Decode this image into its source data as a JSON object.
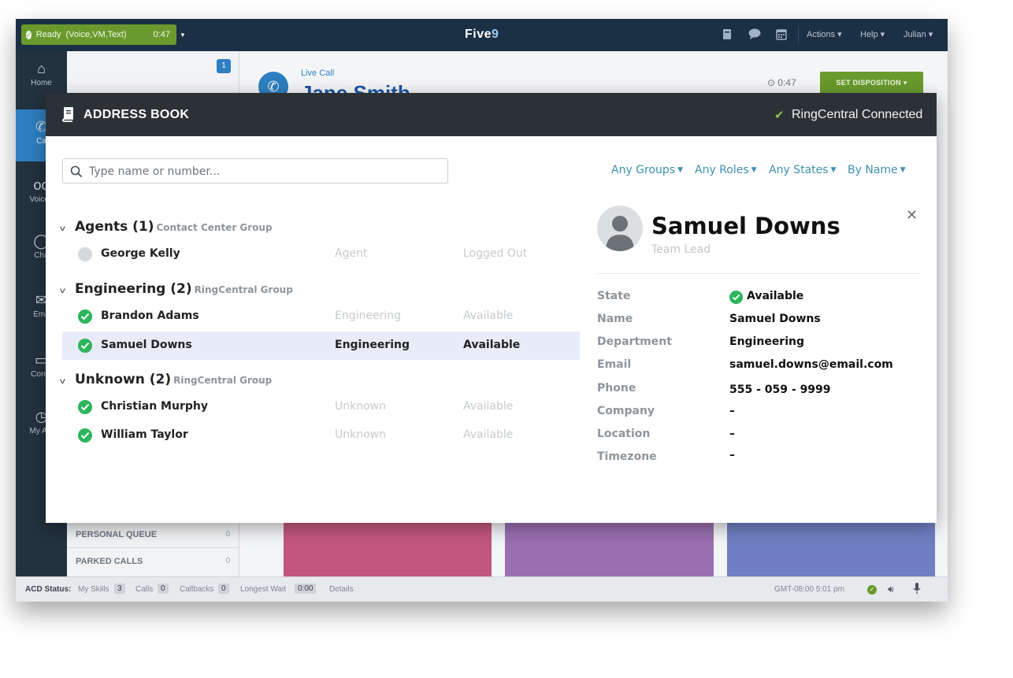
{
  "app": {
    "status_label": "Ready",
    "status_channels": "(Voice,VM,Text)",
    "status_timer": "0:47",
    "logo_text": "Five",
    "logo_nine": "9",
    "menu_actions": "Actions ▾",
    "menu_help": "Help ▾",
    "menu_user": "Julian ▾",
    "nav": [
      {
        "label": "Home",
        "icon": "home-icon"
      },
      {
        "label": "Ca",
        "icon": "phone-icon"
      },
      {
        "label": "Voicen",
        "icon": "voicemail-icon"
      },
      {
        "label": "Cha",
        "icon": "chat-icon"
      },
      {
        "label": "Ema",
        "icon": "email-icon"
      },
      {
        "label": "Conta",
        "icon": "folder-icon"
      },
      {
        "label": "My Act",
        "icon": "clock-icon"
      }
    ],
    "queue_badge": "1",
    "queues": [
      {
        "label": "PERSONAL QUEUE",
        "count": "0"
      },
      {
        "label": "PARKED CALLS",
        "count": "0"
      }
    ],
    "call": {
      "live_label": "Live Call",
      "caller_name": "Jane Smith",
      "timer": "⊙ 0:47",
      "disposition_label": "SET DISPOSITION ▾"
    },
    "footer": {
      "acd_label": "ACD Status:",
      "skills_label": "My Skills",
      "skills_count": "3",
      "calls_label": "Calls",
      "calls_count": "0",
      "callbacks_label": "Callbacks",
      "callbacks_count": "0",
      "wait_label": "Longest Wait",
      "wait_value": "0:00",
      "details_label": "Details",
      "clock": "GMT-08:00 5:01 pm"
    },
    "tile_colors": [
      "#c2577e",
      "#9a6fb0",
      "#6f7fc2"
    ]
  },
  "modal": {
    "title": "ADDRESS BOOK",
    "connection_status": "RingCentral Connected",
    "search_placeholder": "Type name or number...",
    "filters": [
      "Any Groups",
      "Any Roles",
      "Any States",
      "By Name"
    ],
    "groups": [
      {
        "name": "Agents (1)",
        "type": "Contact Center Group",
        "contacts": [
          {
            "name": "George Kelly",
            "department": "Agent",
            "state": "Logged Out",
            "online": false,
            "selected": false
          }
        ]
      },
      {
        "name": "Engineering (2)",
        "type": "RingCentral Group",
        "contacts": [
          {
            "name": "Brandon Adams",
            "department": "Engineering",
            "state": "Available",
            "online": true,
            "selected": false
          },
          {
            "name": "Samuel Downs",
            "department": "Engineering",
            "state": "Available",
            "online": true,
            "selected": true
          }
        ]
      },
      {
        "name": "Unknown (2)",
        "type": "RingCentral Group",
        "contacts": [
          {
            "name": "Christian Murphy",
            "department": "Unknown",
            "state": "Available",
            "online": true,
            "selected": false
          },
          {
            "name": "William Taylor",
            "department": "Unknown",
            "state": "Available",
            "online": true,
            "selected": false
          }
        ]
      }
    ],
    "detail": {
      "name": "Samuel Downs",
      "role": "Team Lead",
      "close_glyph": "✕",
      "fields": [
        {
          "label": "State",
          "value": "Available"
        },
        {
          "label": "Name",
          "value": "Samuel Downs"
        },
        {
          "label": "Department",
          "value": "Engineering"
        },
        {
          "label": "Email",
          "value": "samuel.downs@email.com"
        },
        {
          "label": "Phone",
          "value": "555 - 059 - 9999"
        },
        {
          "label": "Company",
          "value": "–"
        },
        {
          "label": "Location",
          "value": "–"
        },
        {
          "label": "Timezone",
          "value": "–"
        }
      ]
    },
    "colors": {
      "accent": "#3f8fb0",
      "available": "#2db55d",
      "header": "#2c3136",
      "selected_row": "#e8ebf8"
    }
  }
}
